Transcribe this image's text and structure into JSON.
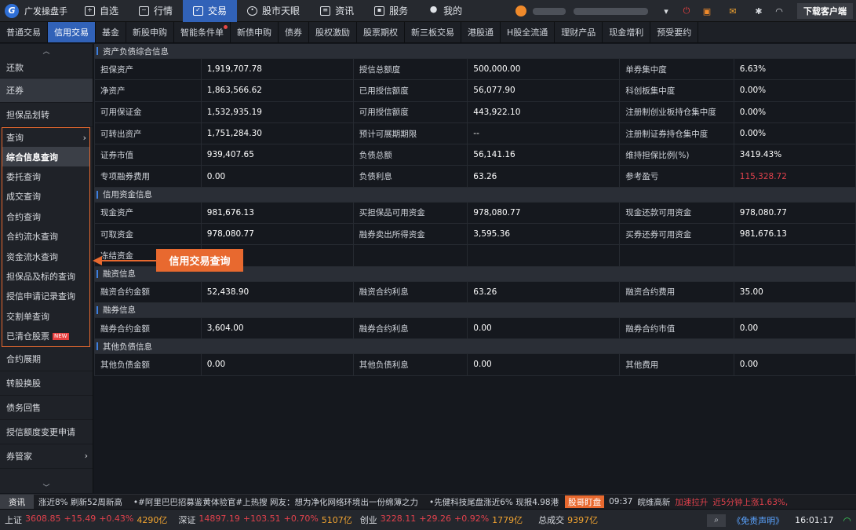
{
  "brand": {
    "name": "广发操盘手",
    "logo": "G"
  },
  "nav": [
    {
      "label": "自选",
      "icon": "plus-square-icon",
      "active": false
    },
    {
      "label": "行情",
      "icon": "chart-line-icon",
      "active": false
    },
    {
      "label": "交易",
      "icon": "trade-icon",
      "active": true
    },
    {
      "label": "股市天眼",
      "icon": "eye-icon",
      "active": false
    },
    {
      "label": "资讯",
      "icon": "news-icon",
      "active": false
    },
    {
      "label": "服务",
      "icon": "briefcase-icon",
      "active": false
    },
    {
      "label": "我的",
      "icon": "user-icon",
      "active": false
    }
  ],
  "download_label": "下载客户端",
  "subtabs": [
    "普通交易",
    "信用交易",
    "基金",
    "新股申购",
    "智能条件单",
    "新债申购",
    "债券",
    "股权激励",
    "股票期权",
    "新三板交易",
    "港股通",
    "H股全流通",
    "理财产品",
    "现金增利",
    "预受要约"
  ],
  "active_subtab": "信用交易",
  "sidebar": {
    "top_items": [
      "还款",
      "还券",
      "担保品划转"
    ],
    "group_label": "查询",
    "group_items": [
      "综合信息查询",
      "委托查询",
      "成交查询",
      "合约查询",
      "合约流水查询",
      "资金流水查询",
      "担保品及标的查询",
      "授信申请记录查询",
      "交割单查询",
      "已清仓股票"
    ],
    "active_group_item": "综合信息查询",
    "new_badge": "NEW",
    "bottom_items": [
      "合约展期",
      "转股换股",
      "债务回售",
      "授信额度变更申请",
      "券管家"
    ]
  },
  "sections": {
    "asset": {
      "title": "资产负债综合信息",
      "rows": [
        [
          "担保资产",
          "1,919,707.78",
          "授信总额度",
          "500,000.00",
          "单券集中度",
          "6.63%"
        ],
        [
          "净资产",
          "1,863,566.62",
          "已用授信额度",
          "56,077.90",
          "科创板集中度",
          "0.00%"
        ],
        [
          "可用保证金",
          "1,532,935.19",
          "可用授信额度",
          "443,922.10",
          "注册制创业板持仓集中度",
          "0.00%"
        ],
        [
          "可转出资产",
          "1,751,284.30",
          "预计可展期期限",
          "--",
          "注册制证券持仓集中度",
          "0.00%"
        ],
        [
          "证券市值",
          "939,407.65",
          "负债总额",
          "56,141.16",
          "维持担保比例(%)",
          "3419.43%"
        ],
        [
          "专项融券费用",
          "0.00",
          "负债利息",
          "63.26",
          "参考盈亏",
          "115,328.72"
        ]
      ]
    },
    "fund": {
      "title": "信用资金信息",
      "rows": [
        [
          "现金资产",
          "981,676.13",
          "买担保品可用资金",
          "978,080.77",
          "现金还款可用资金",
          "978,080.77"
        ],
        [
          "可取资金",
          "978,080.77",
          "融券卖出所得资金",
          "3,595.36",
          "买券还券可用资金",
          "981,676.13"
        ],
        [
          "冻结资金",
          "",
          "",
          "",
          "",
          ""
        ]
      ]
    },
    "margin": {
      "title": "融资信息",
      "rows": [
        [
          "融资合约金额",
          "52,438.90",
          "融资合约利息",
          "63.26",
          "融资合约费用",
          "35.00"
        ]
      ]
    },
    "short": {
      "title": "融券信息",
      "rows": [
        [
          "融券合约金额",
          "3,604.00",
          "融券合约利息",
          "0.00",
          "融券合约市值",
          "0.00"
        ]
      ]
    },
    "other": {
      "title": "其他负债信息",
      "rows": [
        [
          "其他负债金额",
          "0.00",
          "其他负债利息",
          "0.00",
          "其他费用",
          "0.00"
        ]
      ]
    }
  },
  "callout": "信用交易查询",
  "ticker": {
    "label": "资讯",
    "items": [
      "涨近8% 刷新52周新高",
      "•#阿里巴巴招募鉴黄体验官#上热搜 网友：想为净化网络环境出一份绵薄之力",
      "•先健科技尾盘涨近6% 现报4.98港"
    ],
    "badge": "股哥盯盘",
    "time": "09:37",
    "stock": "皖维高新",
    "alert1": "加速拉升",
    "alert2": "近5分钟上涨1.63%,"
  },
  "status": {
    "indices": [
      {
        "name": "上证",
        "price": "3608.85",
        "change": "+15.49",
        "pct": "+0.43%",
        "amount": "4290亿"
      },
      {
        "name": "深证",
        "price": "14897.19",
        "change": "+103.51",
        "pct": "+0.70%",
        "amount": "5107亿"
      },
      {
        "name": "创业",
        "price": "3228.11",
        "change": "+29.26",
        "pct": "+0.92%",
        "amount": "1779亿"
      }
    ],
    "total_label": "总成交",
    "total_value": "9397亿",
    "disclaimer": "《免责声明》",
    "clock": "16:01:17"
  },
  "colors": {
    "accent": "#3162b8",
    "highlight": "#e8692f",
    "negative": "#e0414c"
  }
}
